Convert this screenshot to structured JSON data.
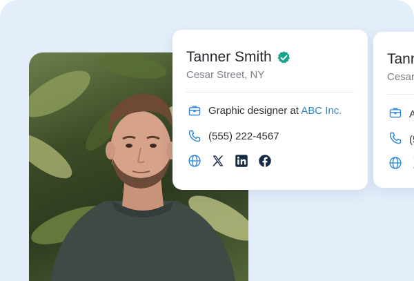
{
  "profile": {
    "name": "Tanner Smith",
    "address": "Cesar Street, NY",
    "job_prefix": "Graphic designer at",
    "company": "ABC Inc.",
    "phone": "(555) 222-4567",
    "verified": true
  },
  "peek_card": {
    "name_fragment": "Tann",
    "address_fragment": "Cesar",
    "job_fragment": "A",
    "phone_fragment": "(5"
  },
  "icons": {
    "job": "briefcase-icon",
    "phone": "phone-icon",
    "website": "globe-icon",
    "x": "x-icon",
    "linkedin": "linkedin-icon",
    "facebook": "facebook-icon",
    "verified": "verified-badge-icon"
  },
  "colors": {
    "background": "#e3eefa",
    "accent_blue": "#2c86d8",
    "verified_green": "#1aa58a",
    "social_dark": "#142a44"
  }
}
